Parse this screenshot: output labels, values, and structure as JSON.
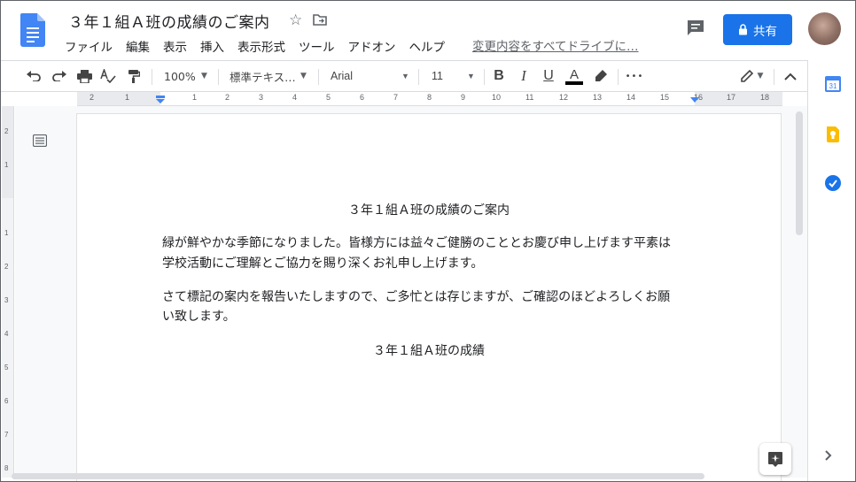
{
  "header": {
    "doc_title": "３年１組Ａ班の成績のご案内",
    "star_glyph": "☆",
    "menu": [
      "ファイル",
      "編集",
      "表示",
      "挿入",
      "表示形式",
      "ツール",
      "アドオン",
      "ヘルプ"
    ],
    "save_status": "変更内容をすべてドライブに…",
    "share_label": "共有",
    "accent_color": "#1a73e8"
  },
  "toolbar": {
    "zoom": "100%",
    "style": "標準テキス…",
    "font": "Arial",
    "font_size": "11",
    "bold": "B",
    "italic": "I",
    "underline": "U",
    "text_color": "A",
    "more": "•••"
  },
  "ruler": {
    "numbers": [
      "2",
      "1",
      "1",
      "2",
      "3",
      "4",
      "5",
      "6",
      "7",
      "8",
      "9",
      "10",
      "11",
      "12",
      "13",
      "14",
      "15",
      "16",
      "17",
      "18"
    ],
    "vertical_numbers": [
      "2",
      "1",
      "1",
      "2",
      "3",
      "4",
      "5",
      "6",
      "7",
      "8"
    ]
  },
  "document": {
    "heading": "３年１組Ａ班の成績のご案内",
    "para1_line1": "緑が鮮やかな季節になりました。皆様方には益々ご健勝のこととお慶び申し上げます平素は",
    "para1_line2": "学校活動にご理解とご協力を賜り深くお礼申し上げます。",
    "para2_line1": "さて標記の案内を報告いたしますので、ご多忙とは存じますが、ご確認のほどよろしくお願",
    "para2_line2": "い致します。",
    "subheading": "３年１組Ａ班の成績"
  },
  "sidepanel": {
    "calendar_number": "31"
  }
}
